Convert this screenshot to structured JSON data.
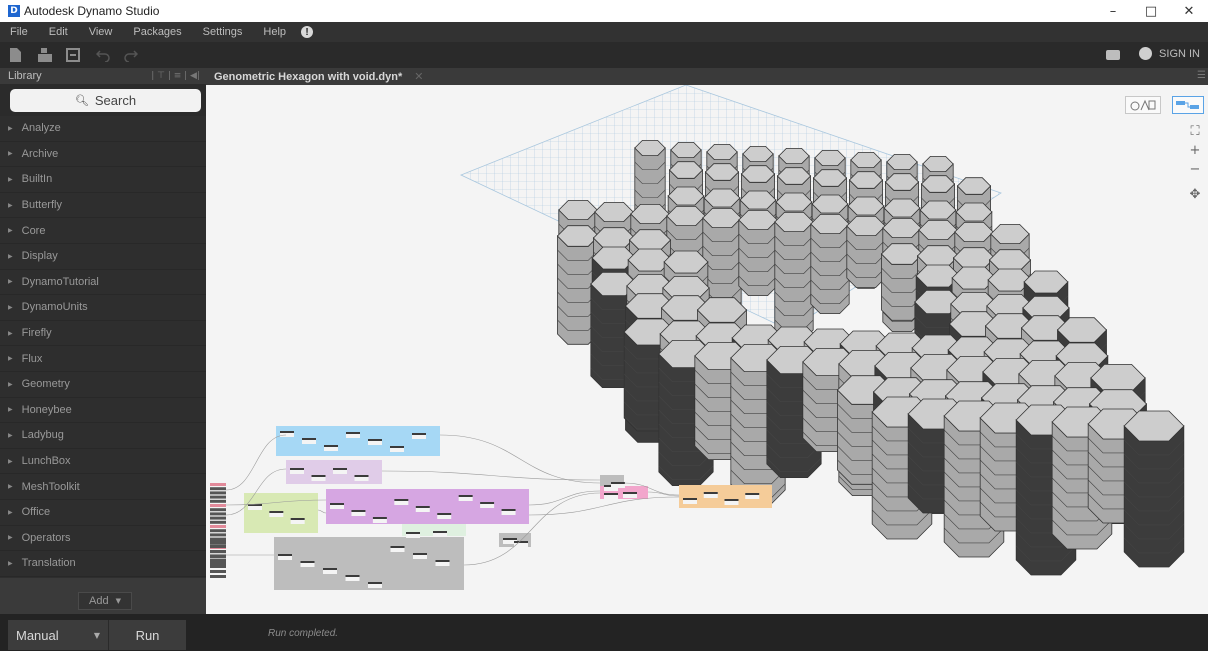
{
  "window": {
    "title": "Autodesk Dynamo Studio",
    "logo_letter": "D",
    "controls": [
      "–",
      "□",
      "✕"
    ]
  },
  "menu": {
    "items": [
      "File",
      "Edit",
      "View",
      "Packages",
      "Settings",
      "Help"
    ],
    "alert_glyph": "!"
  },
  "toolbar": {
    "icons": [
      "new-file-icon",
      "open-icon",
      "save-icon",
      "undo-icon",
      "redo-icon"
    ],
    "sign_in": "SIGN IN"
  },
  "library": {
    "header": "Library",
    "search_placeholder": "Search",
    "items": [
      "Analyze",
      "Archive",
      "BuiltIn",
      "Butterfly",
      "Core",
      "Display",
      "DynamoTutorial",
      "DynamoUnits",
      "Firefly",
      "Flux",
      "Geometry",
      "Honeybee",
      "Ladybug",
      "LunchBox",
      "MeshToolkit",
      "Office",
      "Operators",
      "Translation"
    ],
    "add_label": "Add"
  },
  "workspace": {
    "tab_label": "Genometric Hexagon with void.dyn*"
  },
  "run": {
    "mode": "Manual",
    "run_label": "Run",
    "status": "Run completed."
  },
  "colors": {
    "group_blue": "#a6d8f5",
    "group_lavender": "#e0cce8",
    "group_green": "#d8e9b4",
    "group_purple": "#d6a6e2",
    "group_gray": "#bdbdbd",
    "group_pink": "#f2a6cc",
    "group_orange": "#f5cc99",
    "hex_top": "#cdcdcd",
    "hex_side": "#a9a9a9",
    "hex_dark": "#3c3c3c"
  }
}
